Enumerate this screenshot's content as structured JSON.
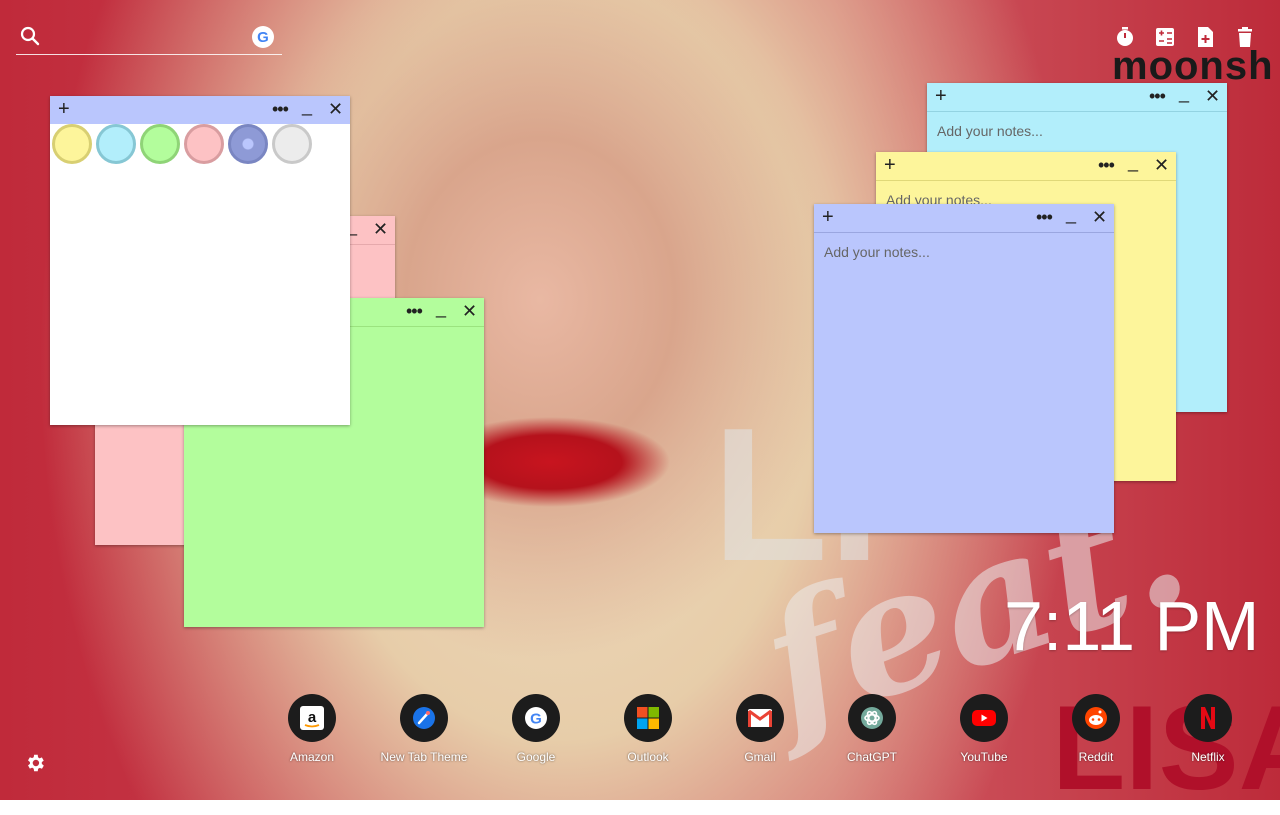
{
  "search": {
    "icon": "search-icon",
    "engine_icon": "google-icon",
    "engine_glyph": "G"
  },
  "top_icons": [
    "timer-icon",
    "calculator-icon",
    "new-note-icon",
    "trash-icon"
  ],
  "brand": {
    "text": "moonsh"
  },
  "notes": [
    {
      "id": "white",
      "placeholder": "",
      "plus": "+",
      "dots": "•••",
      "min": "_",
      "close": "✕"
    },
    {
      "id": "pink",
      "placeholder": "",
      "close": "✕",
      "min": "_"
    },
    {
      "id": "green",
      "placeholder": "",
      "dots": "•••",
      "min": "_",
      "close": "✕"
    },
    {
      "id": "cyan",
      "placeholder": "Add your notes...",
      "plus": "+",
      "dots": "•••",
      "min": "_",
      "close": "✕"
    },
    {
      "id": "yellow",
      "placeholder": "Add your notes...",
      "plus": "+",
      "dots": "•••",
      "min": "_",
      "close": "✕"
    },
    {
      "id": "blue",
      "placeholder": "Add your notes...",
      "plus": "+",
      "dots": "•••",
      "min": "_",
      "close": "✕"
    }
  ],
  "colors": {
    "note_yellow": "#fdf59b",
    "note_cyan": "#b2eefb",
    "note_green": "#b3fd9c",
    "note_pink": "#fdc2c4",
    "note_blue": "#bac6fd",
    "note_white": "#ffffff",
    "swatch_gray": "#ececec"
  },
  "clock": {
    "time": "7:11 PM"
  },
  "background_text": {
    "lisa": "LISA",
    "feat": "feat.",
    "li": "LI"
  },
  "apps": [
    {
      "label": "Amazon",
      "icon": "amazon-icon"
    },
    {
      "label": "New Tab Theme",
      "icon": "new-tab-theme-icon"
    },
    {
      "label": "Google",
      "icon": "google-icon"
    },
    {
      "label": "Outlook",
      "icon": "outlook-icon"
    },
    {
      "label": "Gmail",
      "icon": "gmail-icon"
    },
    {
      "label": "ChatGPT",
      "icon": "chatgpt-icon"
    },
    {
      "label": "YouTube",
      "icon": "youtube-icon"
    },
    {
      "label": "Reddit",
      "icon": "reddit-icon"
    },
    {
      "label": "Netflix",
      "icon": "netflix-icon"
    }
  ],
  "settings": {
    "icon": "gear-icon"
  }
}
